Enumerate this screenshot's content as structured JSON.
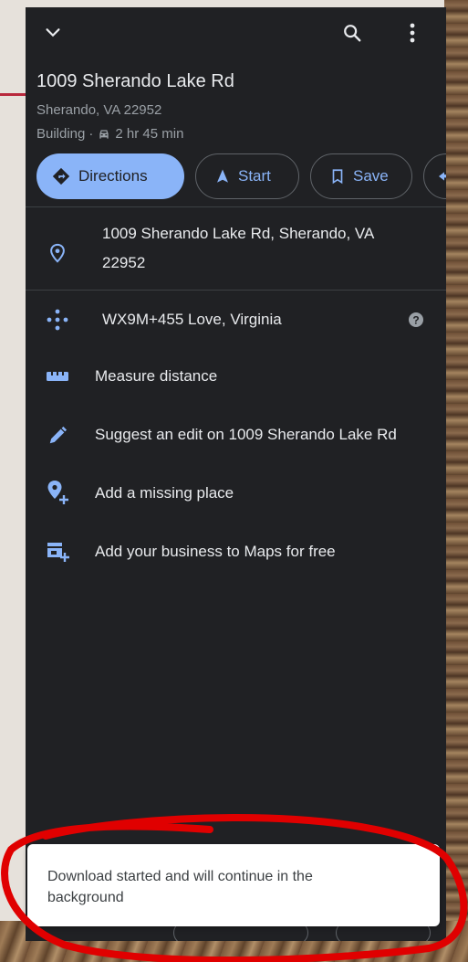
{
  "header": {
    "back_icon": "chevron-down-icon",
    "search_icon": "search-icon",
    "menu_icon": "more-vert-icon"
  },
  "place": {
    "title": "1009 Sherando Lake Rd",
    "subtitle": "Sherando, VA 22952",
    "type": "Building",
    "separator": " · ",
    "drive_time": "2 hr 45 min"
  },
  "actions": [
    {
      "label": "Directions",
      "icon": "directions-icon"
    },
    {
      "label": "Start",
      "icon": "navigation-arrow-icon"
    },
    {
      "label": "Save",
      "icon": "bookmark-icon"
    },
    {
      "label": "",
      "icon": "share-icon"
    }
  ],
  "details": {
    "address_line1": "1009 Sherando Lake Rd, Sherando, VA",
    "address_line2": "22952",
    "plus_code": "WX9M+455 Love, Virginia",
    "measure": "Measure distance",
    "suggest_edit": "Suggest an edit on 1009 Sherando Lake Rd",
    "add_place": "Add a missing place",
    "add_business": "Add your business to Maps for free"
  },
  "toast": {
    "line1": "Download started and will continue in the",
    "line2": "background"
  },
  "colors": {
    "panel_bg": "#202124",
    "accent": "#8ab4f8",
    "text": "#e8eaed",
    "muted": "#9aa0a6",
    "annotation": "#e00000"
  }
}
